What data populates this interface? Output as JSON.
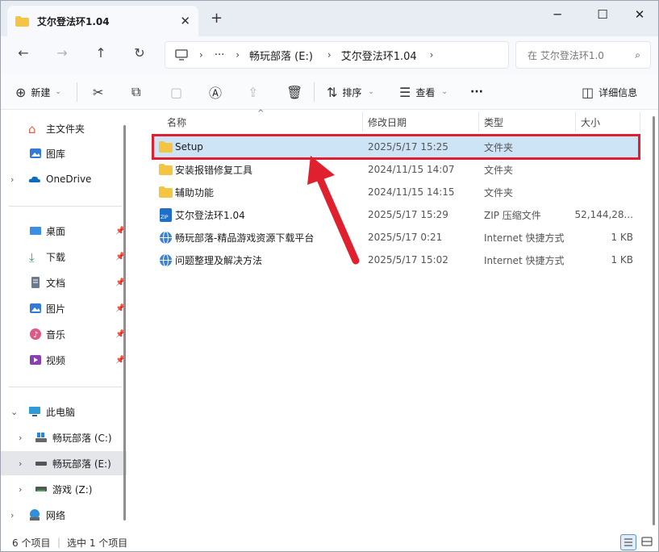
{
  "window": {
    "tab_title": "艾尔登法环1.04",
    "new_tab": "+",
    "close_tab": "✕",
    "minimize": "─",
    "maximize": "☐",
    "close": "✕"
  },
  "address": {
    "ellipsis": "···",
    "crumbs": [
      "畅玩部落 (E:)",
      "艾尔登法环1.04"
    ],
    "search_placeholder": "在 艾尔登法环1.0"
  },
  "commands": {
    "new_label": "新建",
    "sort_label": "排序",
    "view_label": "查看",
    "more": "···",
    "details_label": "详细信息"
  },
  "sidebar": {
    "items": [
      {
        "label": "主文件夹"
      },
      {
        "label": "图库"
      },
      {
        "label": "OneDrive"
      },
      {
        "label": "桌面"
      },
      {
        "label": "下载"
      },
      {
        "label": "文档"
      },
      {
        "label": "图片"
      },
      {
        "label": "音乐"
      },
      {
        "label": "视频"
      },
      {
        "label": "此电脑"
      },
      {
        "label": "畅玩部落 (C:)"
      },
      {
        "label": "畅玩部落 (E:)"
      },
      {
        "label": "游戏 (Z:)"
      },
      {
        "label": "网络"
      }
    ]
  },
  "columns": {
    "name": "名称",
    "date": "修改日期",
    "type": "类型",
    "size": "大小"
  },
  "files": [
    {
      "name": "Setup",
      "date": "2025/5/17 15:25",
      "type": "文件夹",
      "size": ""
    },
    {
      "name": "安装报错修复工具",
      "date": "2024/11/15 14:07",
      "type": "文件夹",
      "size": ""
    },
    {
      "name": "辅助功能",
      "date": "2024/11/15 14:15",
      "type": "文件夹",
      "size": ""
    },
    {
      "name": "艾尔登法环1.04",
      "date": "2025/5/17 15:29",
      "type": "ZIP 压缩文件",
      "size": "52,144,28..."
    },
    {
      "name": "畅玩部落-精品游戏资源下载平台",
      "date": "2025/5/17 0:21",
      "type": "Internet 快捷方式",
      "size": "1 KB"
    },
    {
      "name": "问题整理及解决方法",
      "date": "2025/5/17 15:02",
      "type": "Internet 快捷方式",
      "size": "1 KB"
    }
  ],
  "status": {
    "count": "6 个项目",
    "selected": "选中 1 个项目"
  },
  "colors": {
    "highlight_outline": "#e0202f",
    "selection_fill": "#cde3f6",
    "folder_yellow": "#f4c542"
  }
}
